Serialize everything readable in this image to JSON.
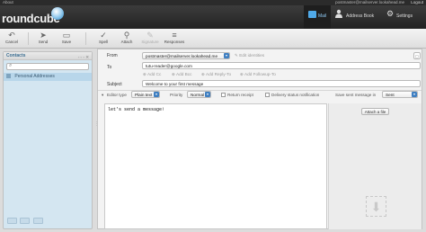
{
  "topbar": {
    "about": "About",
    "user": "postmaster@mailserver.lookahead.me",
    "logout": "Logout"
  },
  "app": {
    "logo_text": "roundcube"
  },
  "nav": {
    "mail": "Mail",
    "address_book": "Address Book",
    "settings": "Settings",
    "settings_icon": "gear-icon"
  },
  "toolbar": {
    "cancel": "Cancel",
    "send": "Send",
    "save": "Save",
    "spell": "Spell",
    "attach": "Attach",
    "signature": "Signature",
    "responses": "Responses"
  },
  "sidebar": {
    "title": "Contacts",
    "search_placeholder": "",
    "address_book": "Personal Addresses"
  },
  "compose": {
    "from_label": "From",
    "from_value": "postmaster@mailserver.lookahead.me",
    "edit_identities": "Edit identities",
    "to_label": "To",
    "to_value": "tutu-reader@google.com",
    "add_cc": "Add Cc",
    "add_bcc": "Add Bcc",
    "add_reply_to": "Add Reply-To",
    "add_followup_to": "Add Followup-To",
    "subject_label": "Subject",
    "subject_value": "Welcome to your first message",
    "editor_type_label": "Editor type",
    "editor_type_value": "Plain text",
    "priority_label": "Priority",
    "priority_value": "Normal",
    "return_receipt": "Return receipt",
    "delivery_status": "Delivery status notification",
    "save_sent_label": "Save sent message in",
    "save_sent_value": "Sent",
    "body": "let's send a message!",
    "attach_file": "Attach a file"
  },
  "colors": {
    "accent": "#3f7fc1",
    "header_bg": "#2b2b2b",
    "sidebar_bg": "#d4e6f1"
  }
}
